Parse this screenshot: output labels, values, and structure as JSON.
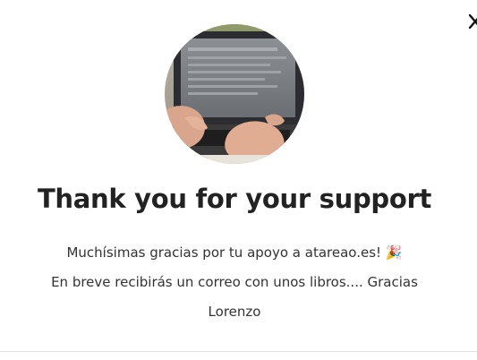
{
  "dialog": {
    "close_icon": "close-icon",
    "avatar_icon": "profile-photo",
    "title": "Thank you for your support",
    "message_line1": "Muchísimas gracias por tu apoyo a atareao.es!",
    "message_emoji": "🎉",
    "message_line2": "En breve recibirás un correo con unos libros.... Gracias Lorenzo"
  }
}
